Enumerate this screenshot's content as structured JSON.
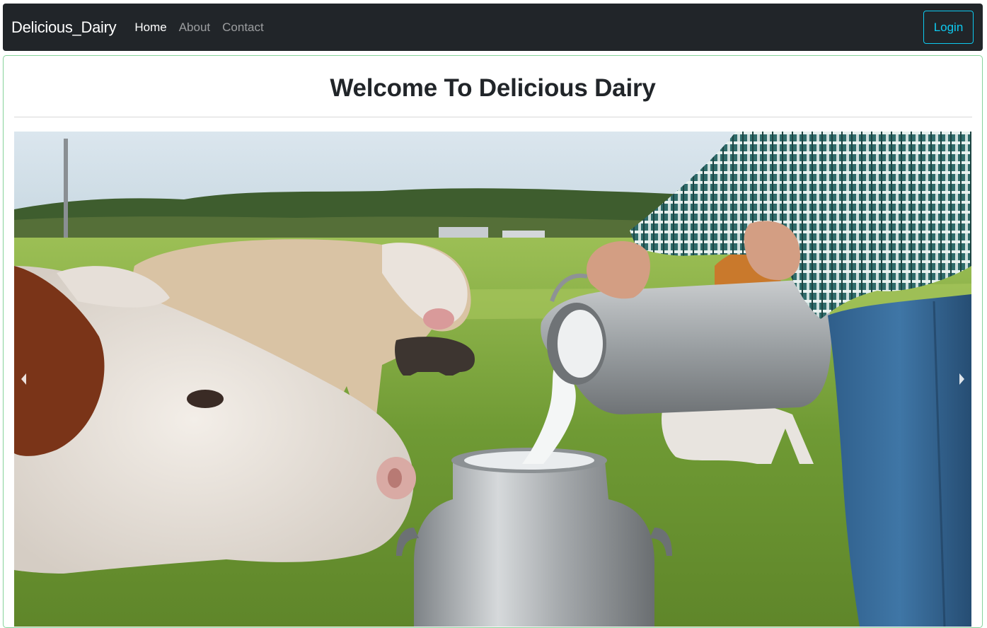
{
  "navbar": {
    "brand": "Delicious_Dairy",
    "links": [
      {
        "label": "Home",
        "active": true
      },
      {
        "label": "About",
        "active": false
      },
      {
        "label": "Contact",
        "active": false
      }
    ],
    "login_label": "Login"
  },
  "main": {
    "title": "Welcome To Delicious Dairy"
  },
  "carousel": {
    "prev_icon": "chevron-left-icon",
    "next_icon": "chevron-right-icon"
  },
  "colors": {
    "navbar_bg": "#212529",
    "accent": "#0dcaf0",
    "card_border": "#86d39a"
  }
}
